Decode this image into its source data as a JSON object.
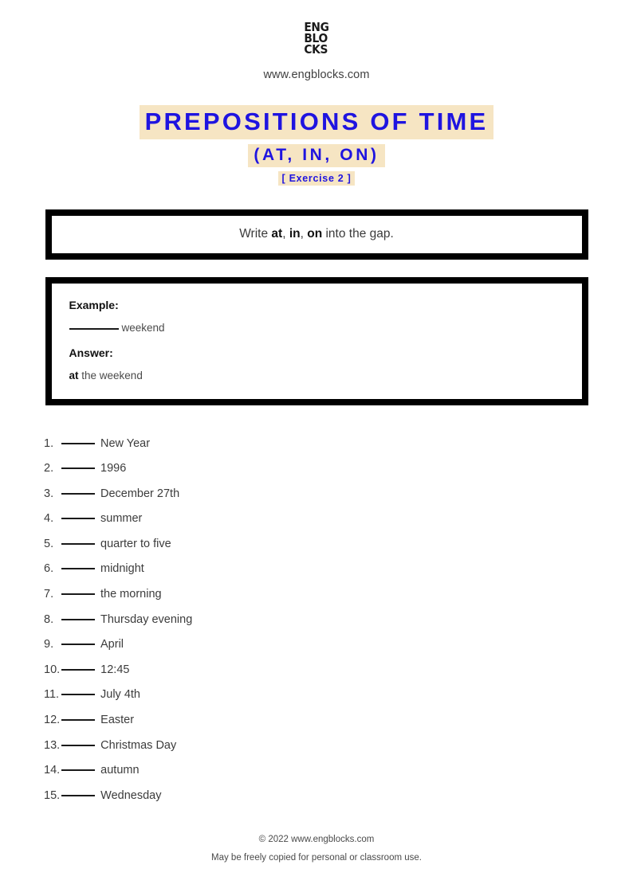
{
  "header": {
    "logo_lines": [
      "ENG",
      "BLO",
      "CKS"
    ],
    "logo_name": "engblocks-logo",
    "site_url": "www.engblocks.com"
  },
  "title": {
    "main": "PREPOSITIONS OF TIME",
    "subtitle": "(AT, IN, ON)",
    "exercise_label": "[ Exercise 2 ]",
    "highlight_color": "#f6e5c3",
    "text_color": "#1f14e0"
  },
  "instruction": {
    "prefix": "Write ",
    "bold_1": "at",
    "sep_1": ", ",
    "bold_2": "in",
    "sep_2": ", ",
    "bold_3": "on",
    "suffix": " into the gap."
  },
  "example": {
    "example_label": "Example:",
    "example_text": "weekend",
    "answer_label": "Answer:",
    "answer_bold": "at",
    "answer_rest": " the weekend"
  },
  "items": [
    {
      "num": "1.",
      "text": "New Year"
    },
    {
      "num": "2.",
      "text": "1996"
    },
    {
      "num": "3.",
      "text": "December 27th"
    },
    {
      "num": "4.",
      "text": "summer"
    },
    {
      "num": "5.",
      "text": "quarter to five"
    },
    {
      "num": "6.",
      "text": "midnight"
    },
    {
      "num": "7.",
      "text": "the morning"
    },
    {
      "num": "8.",
      "text": "Thursday evening"
    },
    {
      "num": "9.",
      "text": "April"
    },
    {
      "num": "10.",
      "text": "12:45"
    },
    {
      "num": "11.",
      "text": "July 4th"
    },
    {
      "num": "12.",
      "text": "Easter"
    },
    {
      "num": "13.",
      "text": "Christmas Day"
    },
    {
      "num": "14.",
      "text": "autumn"
    },
    {
      "num": "15.",
      "text": "Wednesday"
    }
  ],
  "footer": {
    "copyright": "© 2022 www.engblocks.com",
    "notice": "May be freely copied for personal or classroom use."
  }
}
